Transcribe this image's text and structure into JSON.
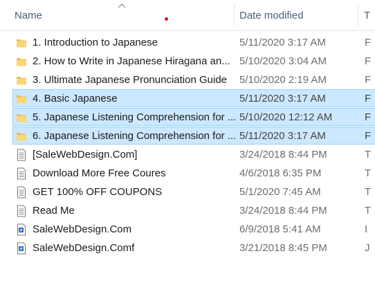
{
  "header": {
    "name_label": "Name",
    "date_label": "Date modified",
    "type_label": "T"
  },
  "files": [
    {
      "name": "1. Introduction to Japanese",
      "date": "5/11/2020 3:17 AM",
      "type": "F",
      "kind": "folder",
      "selected": false
    },
    {
      "name": "2. How to Write in Japanese Hiragana an...",
      "date": "5/10/2020 3:04 AM",
      "type": "F",
      "kind": "folder",
      "selected": false
    },
    {
      "name": "3. Ultimate Japanese Pronunciation Guide",
      "date": "5/10/2020 2:19 AM",
      "type": "F",
      "kind": "folder",
      "selected": false
    },
    {
      "name": "4. Basic Japanese",
      "date": "5/11/2020 3:17 AM",
      "type": "F",
      "kind": "folder",
      "selected": true
    },
    {
      "name": "5. Japanese Listening Comprehension for ...",
      "date": "5/10/2020 12:12 AM",
      "type": "F",
      "kind": "folder",
      "selected": true
    },
    {
      "name": "6. Japanese Listening Comprehension for ...",
      "date": "5/11/2020 3:17 AM",
      "type": "F",
      "kind": "folder",
      "selected": true
    },
    {
      "name": "[SaleWebDesign.Com]",
      "date": "3/24/2018 8:44 PM",
      "type": "T",
      "kind": "text",
      "selected": false
    },
    {
      "name": "Download More Free Coures",
      "date": "4/6/2018 6:35 PM",
      "type": "T",
      "kind": "text",
      "selected": false
    },
    {
      "name": "GET 100% OFF COUPONS",
      "date": "5/1/2020 7:45 AM",
      "type": "T",
      "kind": "text",
      "selected": false
    },
    {
      "name": "Read Me",
      "date": "3/24/2018 8:44 PM",
      "type": "T",
      "kind": "text",
      "selected": false
    },
    {
      "name": "SaleWebDesign.Com",
      "date": "6/9/2018 5:41 AM",
      "type": "I",
      "kind": "shortcut",
      "selected": false
    },
    {
      "name": "SaleWebDesign.Comf",
      "date": "3/21/2018 8:45 PM",
      "type": "J",
      "kind": "shortcut",
      "selected": false
    }
  ],
  "colors": {
    "selection_bg": "#cce8ff",
    "selection_border": "#99d1ff",
    "folder_yellow": "#f8d775",
    "header_text": "#4c607a"
  }
}
